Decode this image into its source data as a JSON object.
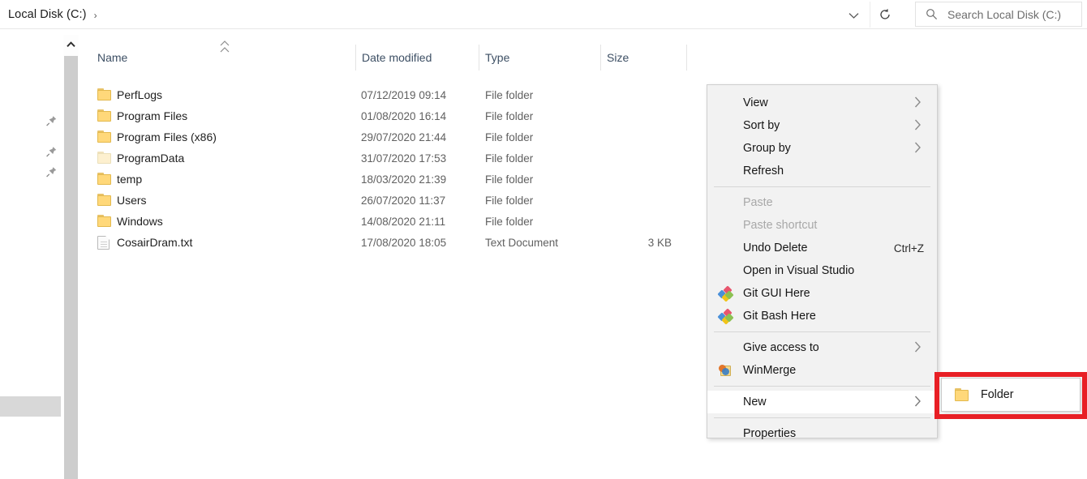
{
  "window": {
    "addressbar": {
      "path_label": "Local Disk (C:)",
      "separator": "›",
      "dropdown_icon": "chevron-down-icon",
      "refresh_icon": "refresh-icon"
    },
    "search": {
      "placeholder": "Search Local Disk (C:)",
      "icon": "search-icon"
    }
  },
  "nav_pane": {
    "pinned_icon": "pin-icon",
    "pinned_count": 3,
    "scrollbar": {
      "up_arrow_icon": "chevron-up-icon"
    }
  },
  "file_list": {
    "columns": [
      {
        "label": "Name"
      },
      {
        "label": "Date modified"
      },
      {
        "label": "Type"
      },
      {
        "label": "Size"
      }
    ],
    "sort_indicator_icon": "chevron-up-icon",
    "rows": [
      {
        "name": "PerfLogs",
        "date": "07/12/2019 09:14",
        "type": "File folder",
        "size": "",
        "icon": "folder-icon"
      },
      {
        "name": "Program Files",
        "date": "01/08/2020 16:14",
        "type": "File folder",
        "size": "",
        "icon": "folder-icon"
      },
      {
        "name": "Program Files (x86)",
        "date": "29/07/2020 21:44",
        "type": "File folder",
        "size": "",
        "icon": "folder-icon"
      },
      {
        "name": "ProgramData",
        "date": "31/07/2020 17:53",
        "type": "File folder",
        "size": "",
        "icon": "folder-hidden-icon"
      },
      {
        "name": "temp",
        "date": "18/03/2020 21:39",
        "type": "File folder",
        "size": "",
        "icon": "folder-icon"
      },
      {
        "name": "Users",
        "date": "26/07/2020 11:37",
        "type": "File folder",
        "size": "",
        "icon": "folder-icon"
      },
      {
        "name": "Windows",
        "date": "14/08/2020 21:11",
        "type": "File folder",
        "size": "",
        "icon": "folder-icon"
      },
      {
        "name": "CosairDram.txt",
        "date": "17/08/2020 18:05",
        "type": "Text Document",
        "size": "3 KB",
        "icon": "text-document-icon"
      }
    ]
  },
  "context_menu": {
    "items": [
      {
        "label": "View",
        "submenu": true,
        "disabled": false,
        "accel": "",
        "icon": ""
      },
      {
        "label": "Sort by",
        "submenu": true,
        "disabled": false,
        "accel": "",
        "icon": ""
      },
      {
        "label": "Group by",
        "submenu": true,
        "disabled": false,
        "accel": "",
        "icon": ""
      },
      {
        "label": "Refresh",
        "submenu": false,
        "disabled": false,
        "accel": "",
        "icon": ""
      },
      {
        "label": "Paste",
        "submenu": false,
        "disabled": true,
        "accel": "",
        "icon": ""
      },
      {
        "label": "Paste shortcut",
        "submenu": false,
        "disabled": true,
        "accel": "",
        "icon": ""
      },
      {
        "label": "Undo Delete",
        "submenu": false,
        "disabled": false,
        "accel": "Ctrl+Z",
        "icon": ""
      },
      {
        "label": "Open in Visual Studio",
        "submenu": false,
        "disabled": false,
        "accel": "",
        "icon": ""
      },
      {
        "label": "Git GUI Here",
        "submenu": false,
        "disabled": false,
        "accel": "",
        "icon": "git-icon"
      },
      {
        "label": "Git Bash Here",
        "submenu": false,
        "disabled": false,
        "accel": "",
        "icon": "git-icon"
      },
      {
        "label": "Give access to",
        "submenu": true,
        "disabled": false,
        "accel": "",
        "icon": ""
      },
      {
        "label": "WinMerge",
        "submenu": false,
        "disabled": false,
        "accel": "",
        "icon": "winmerge-icon"
      },
      {
        "label": "New",
        "submenu": true,
        "disabled": false,
        "accel": "",
        "icon": "",
        "highlighted": true
      },
      {
        "label": "Properties",
        "submenu": false,
        "disabled": false,
        "accel": "",
        "icon": ""
      }
    ]
  },
  "submenu": {
    "items": [
      {
        "label": "Folder",
        "icon": "folder-icon"
      }
    ]
  },
  "annotation": {
    "highlight_color": "#e81f25",
    "shape": "rectangle"
  }
}
